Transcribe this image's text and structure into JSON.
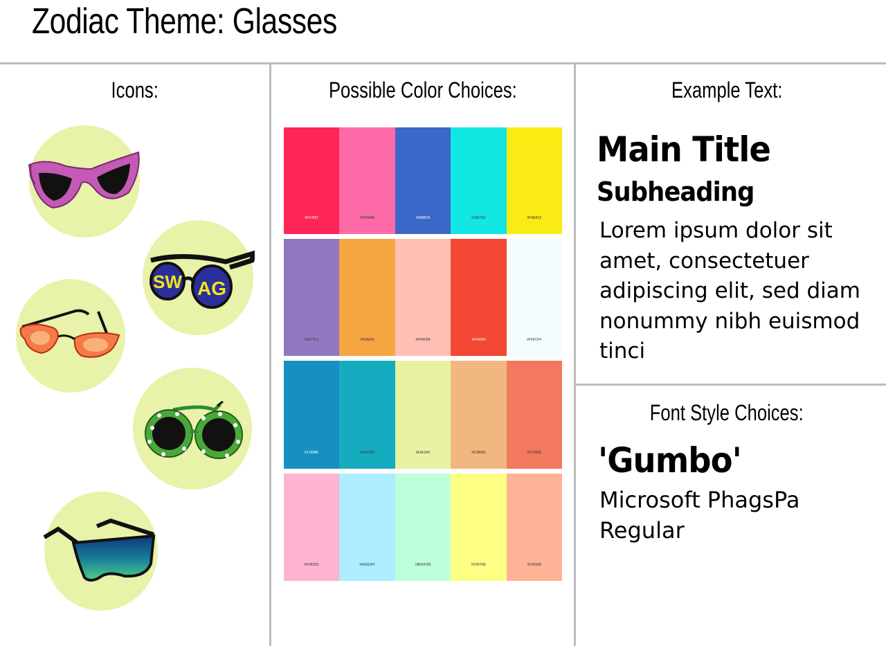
{
  "title": "Zodiac Theme: Glasses",
  "columns": {
    "icons_label": "Icons:",
    "colors_label": "Possible Color Choices:",
    "example_label": "Example Text:",
    "fonts_label": "Font Style Choices:"
  },
  "icons": [
    {
      "name": "cat-eye-glasses-icon"
    },
    {
      "name": "swag-sunglasses-icon",
      "lens_text_left": "SW",
      "lens_text_right": "AG"
    },
    {
      "name": "flame-glasses-icon"
    },
    {
      "name": "flower-sunglasses-icon"
    },
    {
      "name": "shield-sunglasses-icon"
    }
  ],
  "palettes": [
    [
      {
        "hex": "#FF2557",
        "label": "#FF2557",
        "text": "#ffffff"
      },
      {
        "hex": "#FF6AA8",
        "label": "#FF6AA8",
        "text": "#333333"
      },
      {
        "hex": "#3968C8",
        "label": "#3968C8",
        "text": "#ffffff"
      },
      {
        "hex": "#13E7E3",
        "label": "#13E7E3",
        "text": "#333333"
      },
      {
        "hex": "#F9EB13",
        "label": "#F9EB13",
        "text": "#333333"
      }
    ],
    [
      {
        "hex": "#9177C1",
        "label": "#9177C1",
        "text": "#333333"
      },
      {
        "hex": "#F5A542",
        "label": "#F5A542",
        "text": "#333333"
      },
      {
        "hex": "#FFBFB4",
        "label": "#FFBFB4",
        "text": "#333333"
      },
      {
        "hex": "#F44834",
        "label": "#F44834",
        "text": "#ffffff"
      },
      {
        "hex": "#F5FCFF",
        "label": "#F5FCFF",
        "text": "#333333"
      }
    ],
    [
      {
        "hex": "#1790BF",
        "label": "#1790BF",
        "text": "#ffffff"
      },
      {
        "hex": "#15ACBF",
        "label": "#15ACBF",
        "text": "#333333"
      },
      {
        "hex": "#E9F2A2",
        "label": "#E9F2A2",
        "text": "#333333"
      },
      {
        "hex": "#F2B680",
        "label": "#F2B680",
        "text": "#333333"
      },
      {
        "hex": "#F2785E",
        "label": "#F2785E",
        "text": "#333333"
      }
    ],
    [
      {
        "hex": "#FFB2D1",
        "label": "#FFB2D1",
        "text": "#333333"
      },
      {
        "hex": "#ADEDFF",
        "label": "#ADEDFF",
        "text": "#333333"
      },
      {
        "hex": "#BDFFD8",
        "label": "#BDFFD8",
        "text": "#333333"
      },
      {
        "hex": "#FDFF85",
        "label": "#FDFF85",
        "text": "#333333"
      },
      {
        "hex": "#FFB296",
        "label": "#FFB296",
        "text": "#333333"
      }
    ]
  ],
  "example": {
    "main_title": "Main Title",
    "subheading": "Subheading",
    "body": "Lorem ipsum dolor sit amet, consectetuer adipiscing elit, sed diam nonummy nibh euismod tinci"
  },
  "fonts": {
    "heading_font": "'Gumbo'",
    "body_font": "Microsoft PhagsPa Regular"
  },
  "colors": {
    "icon_circle": "#E8F2A8",
    "divider": "#bcbcbc"
  }
}
